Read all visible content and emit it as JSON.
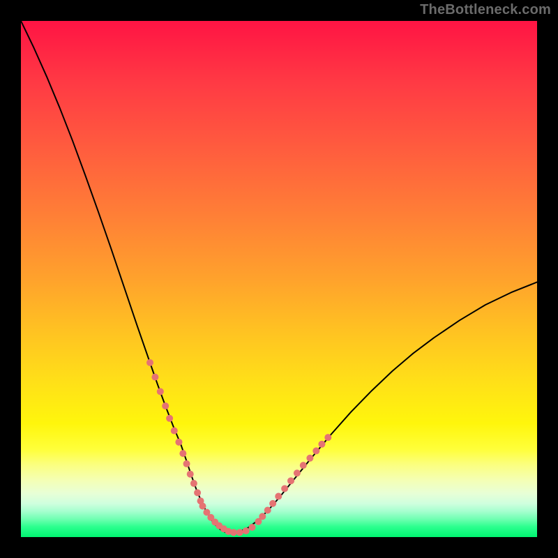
{
  "watermark": "TheBottleneck.com",
  "chart_data": {
    "type": "line",
    "title": "",
    "xlabel": "",
    "ylabel": "",
    "xlim": [
      0,
      100
    ],
    "ylim": [
      0,
      100
    ],
    "grid": false,
    "legend": false,
    "background_gradient": [
      {
        "pos": 0.0,
        "color": "#ff1444"
      },
      {
        "pos": 0.12,
        "color": "#ff3a44"
      },
      {
        "pos": 0.25,
        "color": "#ff5d3e"
      },
      {
        "pos": 0.38,
        "color": "#ff8036"
      },
      {
        "pos": 0.5,
        "color": "#ffa22c"
      },
      {
        "pos": 0.6,
        "color": "#ffc222"
      },
      {
        "pos": 0.7,
        "color": "#ffe018"
      },
      {
        "pos": 0.78,
        "color": "#fff60c"
      },
      {
        "pos": 0.83,
        "color": "#ffff3a"
      },
      {
        "pos": 0.86,
        "color": "#fbff80"
      },
      {
        "pos": 0.89,
        "color": "#f4ffb5"
      },
      {
        "pos": 0.915,
        "color": "#e8ffd6"
      },
      {
        "pos": 0.935,
        "color": "#cfffde"
      },
      {
        "pos": 0.95,
        "color": "#a6ffcf"
      },
      {
        "pos": 0.965,
        "color": "#70ffb2"
      },
      {
        "pos": 0.98,
        "color": "#2cff8e"
      },
      {
        "pos": 1.0,
        "color": "#00f571"
      }
    ],
    "series": [
      {
        "name": "bottleneck-curve",
        "color": "#000000",
        "width": 2.0,
        "x": [
          0.0,
          2.5,
          5.0,
          7.5,
          10.0,
          12.5,
          15.0,
          17.5,
          20.0,
          22.5,
          25.0,
          26.5,
          28.0,
          29.5,
          31.0,
          32.0,
          33.0,
          34.0,
          35.0,
          36.0,
          37.0,
          38.0,
          39.0,
          40.0,
          42.0,
          44.0,
          46.0,
          48.0,
          50.0,
          53.0,
          56.0,
          60.0,
          64.0,
          68.0,
          72.0,
          76.0,
          80.0,
          85.0,
          90.0,
          95.0,
          100.0
        ],
        "y": [
          100.0,
          94.8,
          89.2,
          83.2,
          76.8,
          70.0,
          63.0,
          55.8,
          48.4,
          41.0,
          33.8,
          29.5,
          25.4,
          21.5,
          17.9,
          15.0,
          12.0,
          9.2,
          6.8,
          4.8,
          3.2,
          2.0,
          1.2,
          0.8,
          0.9,
          1.8,
          3.3,
          5.3,
          7.6,
          11.3,
          15.0,
          19.8,
          24.3,
          28.4,
          32.2,
          35.6,
          38.6,
          42.0,
          45.0,
          47.4,
          49.4
        ]
      }
    ],
    "highlight_segments": [
      {
        "name": "left-dots",
        "color": "#e57373",
        "width": 8.0,
        "pattern": "dotted",
        "x": [
          25.0,
          26.0,
          27.0,
          28.0,
          28.8,
          29.7,
          30.6,
          31.4,
          32.1,
          32.8,
          33.5,
          34.2,
          34.8
        ],
        "y": [
          33.8,
          31.0,
          28.2,
          25.4,
          23.0,
          20.6,
          18.4,
          16.2,
          14.2,
          12.2,
          10.4,
          8.6,
          7.0
        ]
      },
      {
        "name": "bottom-dots",
        "color": "#e57373",
        "width": 8.0,
        "pattern": "dotted",
        "x": [
          35.2,
          36.0,
          36.8,
          37.6,
          38.4,
          39.3,
          40.2,
          41.2,
          42.4,
          43.6,
          44.8,
          46.0
        ],
        "y": [
          6.0,
          4.8,
          3.8,
          2.9,
          2.2,
          1.6,
          1.1,
          0.9,
          0.9,
          1.2,
          1.9,
          3.0
        ]
      },
      {
        "name": "right-dots",
        "color": "#e57373",
        "width": 8.0,
        "pattern": "dotted",
        "x": [
          46.8,
          47.8,
          48.8,
          49.9,
          51.1,
          52.3,
          53.5,
          54.7,
          56.0,
          57.2,
          58.3,
          59.5
        ],
        "y": [
          4.0,
          5.2,
          6.5,
          7.9,
          9.4,
          10.9,
          12.4,
          13.9,
          15.3,
          16.7,
          18.0,
          19.3
        ]
      }
    ]
  }
}
